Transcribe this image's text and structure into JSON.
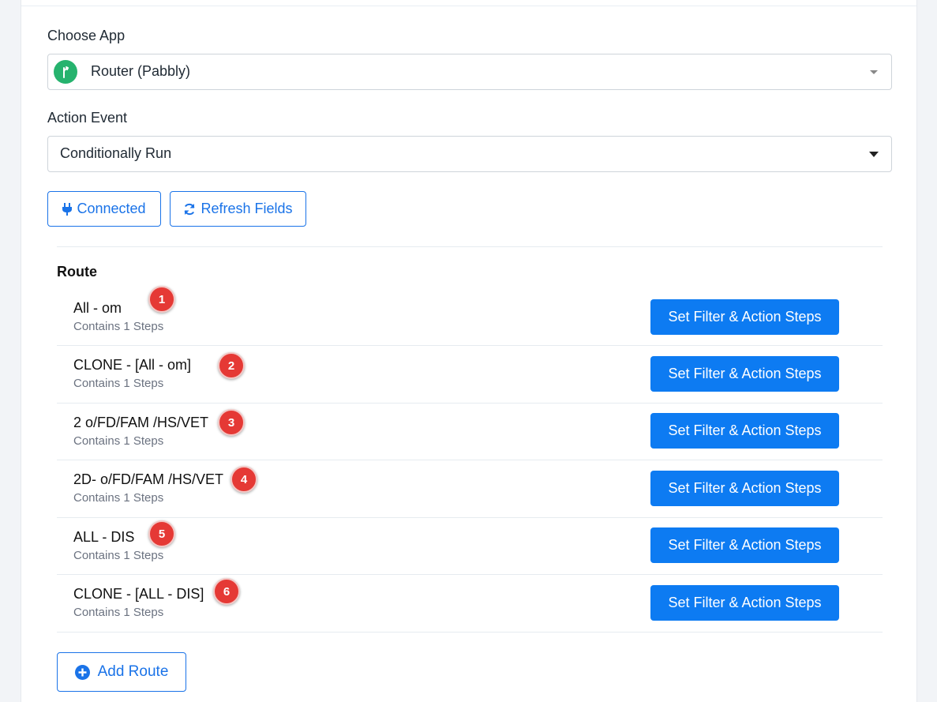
{
  "choose_app": {
    "label": "Choose App",
    "value": "Router (Pabbly)",
    "icon": "router-icon",
    "icon_color": "#26b36e"
  },
  "action_event": {
    "label": "Action Event",
    "value": "Conditionally Run"
  },
  "buttons": {
    "connected": "Connected",
    "refresh": "Refresh Fields"
  },
  "routes_section": {
    "heading": "Route",
    "button_label": "Set Filter & Action Steps",
    "add_route_label": "Add Route",
    "items": [
      {
        "name": "All - om",
        "steps": "Contains 1 Steps",
        "badge": "1"
      },
      {
        "name": "CLONE - [All - om]",
        "steps": "Contains 1 Steps",
        "badge": "2"
      },
      {
        "name": "2 o/FD/FAM /HS/VET",
        "steps": "Contains 1 Steps",
        "badge": "3"
      },
      {
        "name": "2D- o/FD/FAM /HS/VET",
        "steps": "Contains 1 Steps",
        "badge": "4"
      },
      {
        "name": "ALL - DIS",
        "steps": "Contains 1 Steps",
        "badge": "5"
      },
      {
        "name": "CLONE - [ALL - DIS]",
        "steps": "Contains 1 Steps",
        "badge": "6"
      }
    ]
  },
  "colors": {
    "primary": "#0d7bf2",
    "outline": "#1a73e8",
    "badge": "#e53935"
  }
}
